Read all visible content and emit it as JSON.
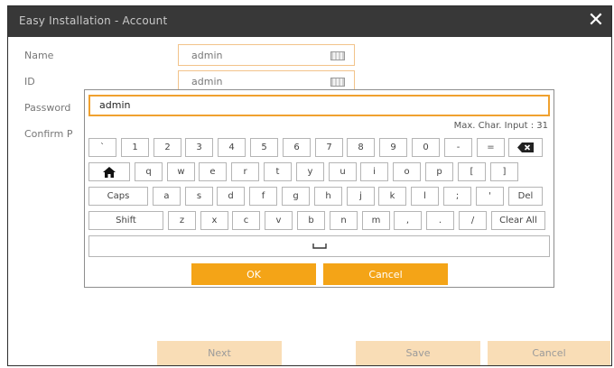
{
  "window": {
    "title": "Easy Installation - Account"
  },
  "form": {
    "name_label": "Name",
    "name_value": "admin",
    "id_label": "ID",
    "id_value": "admin",
    "password_label": "Password",
    "confirm_label": "Confirm P"
  },
  "keyboard": {
    "input_value": "admin",
    "max_text": "Max. Char. Input : 31",
    "rows": [
      [
        "`",
        "1",
        "2",
        "3",
        "4",
        "5",
        "6",
        "7",
        "8",
        "9",
        "0",
        "-",
        "=",
        "backspace-icon"
      ],
      [
        "home-icon",
        "q",
        "w",
        "e",
        "r",
        "t",
        "y",
        "u",
        "i",
        "o",
        "p",
        "[",
        "]"
      ],
      [
        "Caps",
        "a",
        "s",
        "d",
        "f",
        "g",
        "h",
        "j",
        "k",
        "l",
        ";",
        "'",
        "Del"
      ],
      [
        "Shift",
        "z",
        "x",
        "c",
        "v",
        "b",
        "n",
        "m",
        ",",
        ".",
        "/",
        "Clear All"
      ],
      [
        "space-icon"
      ]
    ],
    "ok_label": "OK",
    "cancel_label": "Cancel"
  },
  "footer": {
    "next_label": "Next",
    "save_label": "Save",
    "cancel_label": "Cancel"
  },
  "colors": {
    "accent": "#f4a417",
    "titlebar": "#383838",
    "field_border": "#f2c38a",
    "footer_button": "#f9ddb6"
  }
}
